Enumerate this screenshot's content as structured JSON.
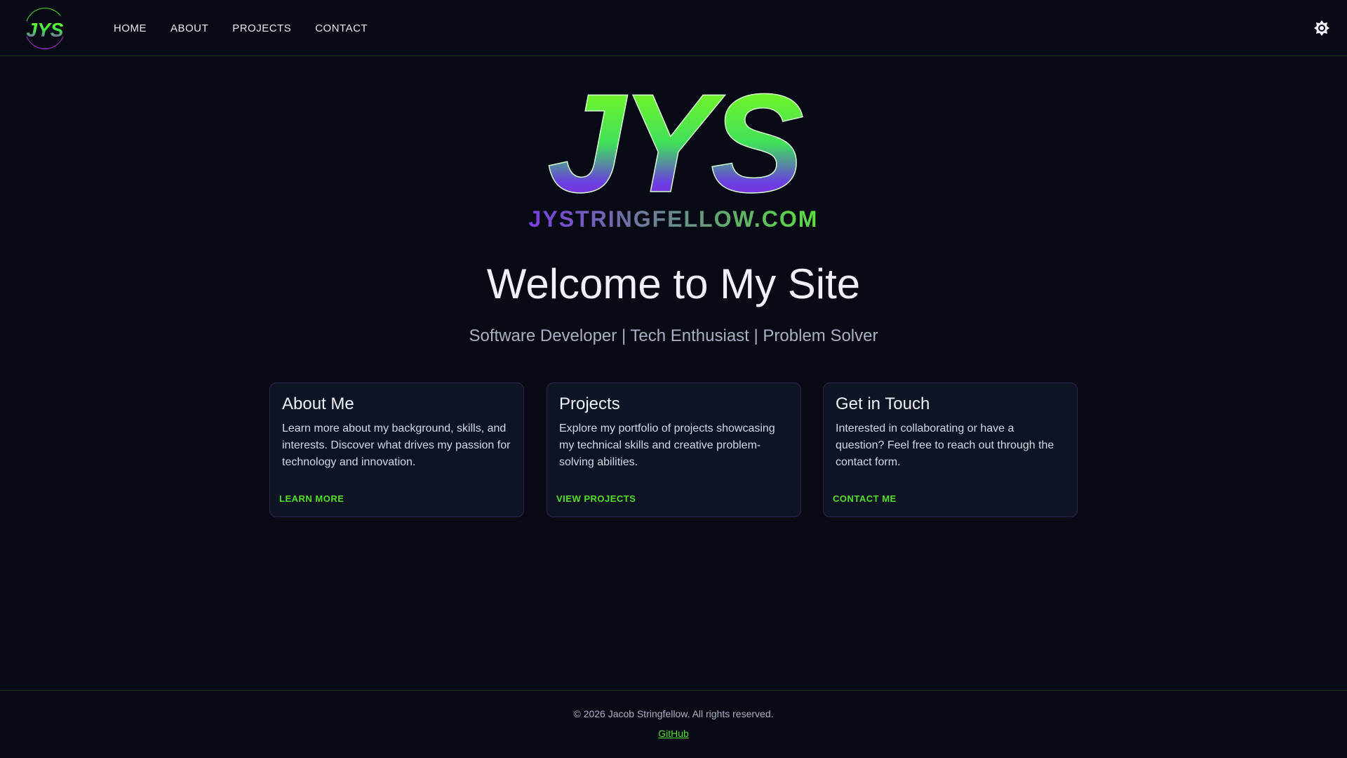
{
  "brand": {
    "logo_text": "JYS",
    "domain_text": "JYSTRINGFELLOW.COM"
  },
  "nav": {
    "items": [
      {
        "label": "HOME"
      },
      {
        "label": "ABOUT"
      },
      {
        "label": "PROJECTS"
      },
      {
        "label": "CONTACT"
      }
    ],
    "theme_icon": "brightness-icon"
  },
  "hero": {
    "title": "Welcome to My Site",
    "subtitle": "Software Developer | Tech Enthusiast | Problem Solver"
  },
  "cards": [
    {
      "title": "About Me",
      "text": "Learn more about my background, skills, and interests. Discover what drives my passion for technology and innovation.",
      "link": "LEARN MORE"
    },
    {
      "title": "Projects",
      "text": "Explore my portfolio of projects showcasing my technical skills and creative problem-solving abilities.",
      "link": "VIEW PROJECTS"
    },
    {
      "title": "Get in Touch",
      "text": "Interested in collaborating or have a question? Feel free to reach out through the contact form.",
      "link": "CONTACT ME"
    }
  ],
  "footer": {
    "copyright": "© 2026 Jacob Stringfellow. All rights reserved.",
    "github": "GitHub"
  },
  "colors": {
    "accent": "#4ee02a",
    "purple": "#9b2ee0",
    "background": "#080b15"
  }
}
